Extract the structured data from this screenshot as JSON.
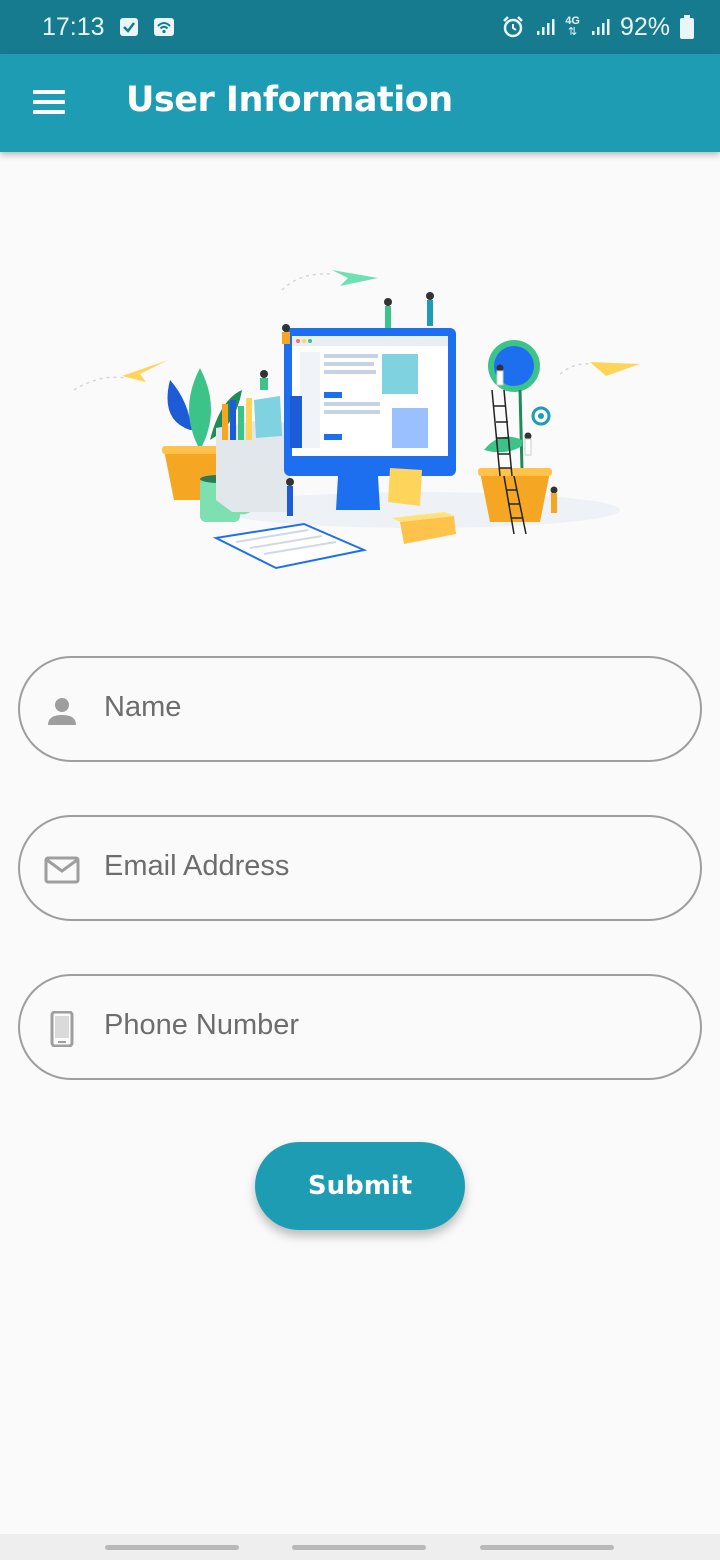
{
  "status_bar": {
    "time": "17:13",
    "battery": "92%",
    "network": "4G",
    "icons": [
      "checkbox-notification-icon",
      "wifi-notification-icon",
      "alarm-icon",
      "signal-icon",
      "network-4g-icon",
      "signal-icon",
      "battery-icon"
    ]
  },
  "app_bar": {
    "title": "User Information",
    "menu_icon": "hamburger-menu-icon",
    "color": "#1e9cb3"
  },
  "form": {
    "name": {
      "placeholder": "Name",
      "icon": "person-icon"
    },
    "email": {
      "placeholder": "Email Address",
      "icon": "mail-icon"
    },
    "phone": {
      "placeholder": "Phone Number",
      "icon": "phone-icon"
    },
    "submit_label": "Submit"
  },
  "colors": {
    "status_bar": "#177b8f",
    "accent": "#1e9cb3",
    "field_border": "#9e9e9e"
  }
}
